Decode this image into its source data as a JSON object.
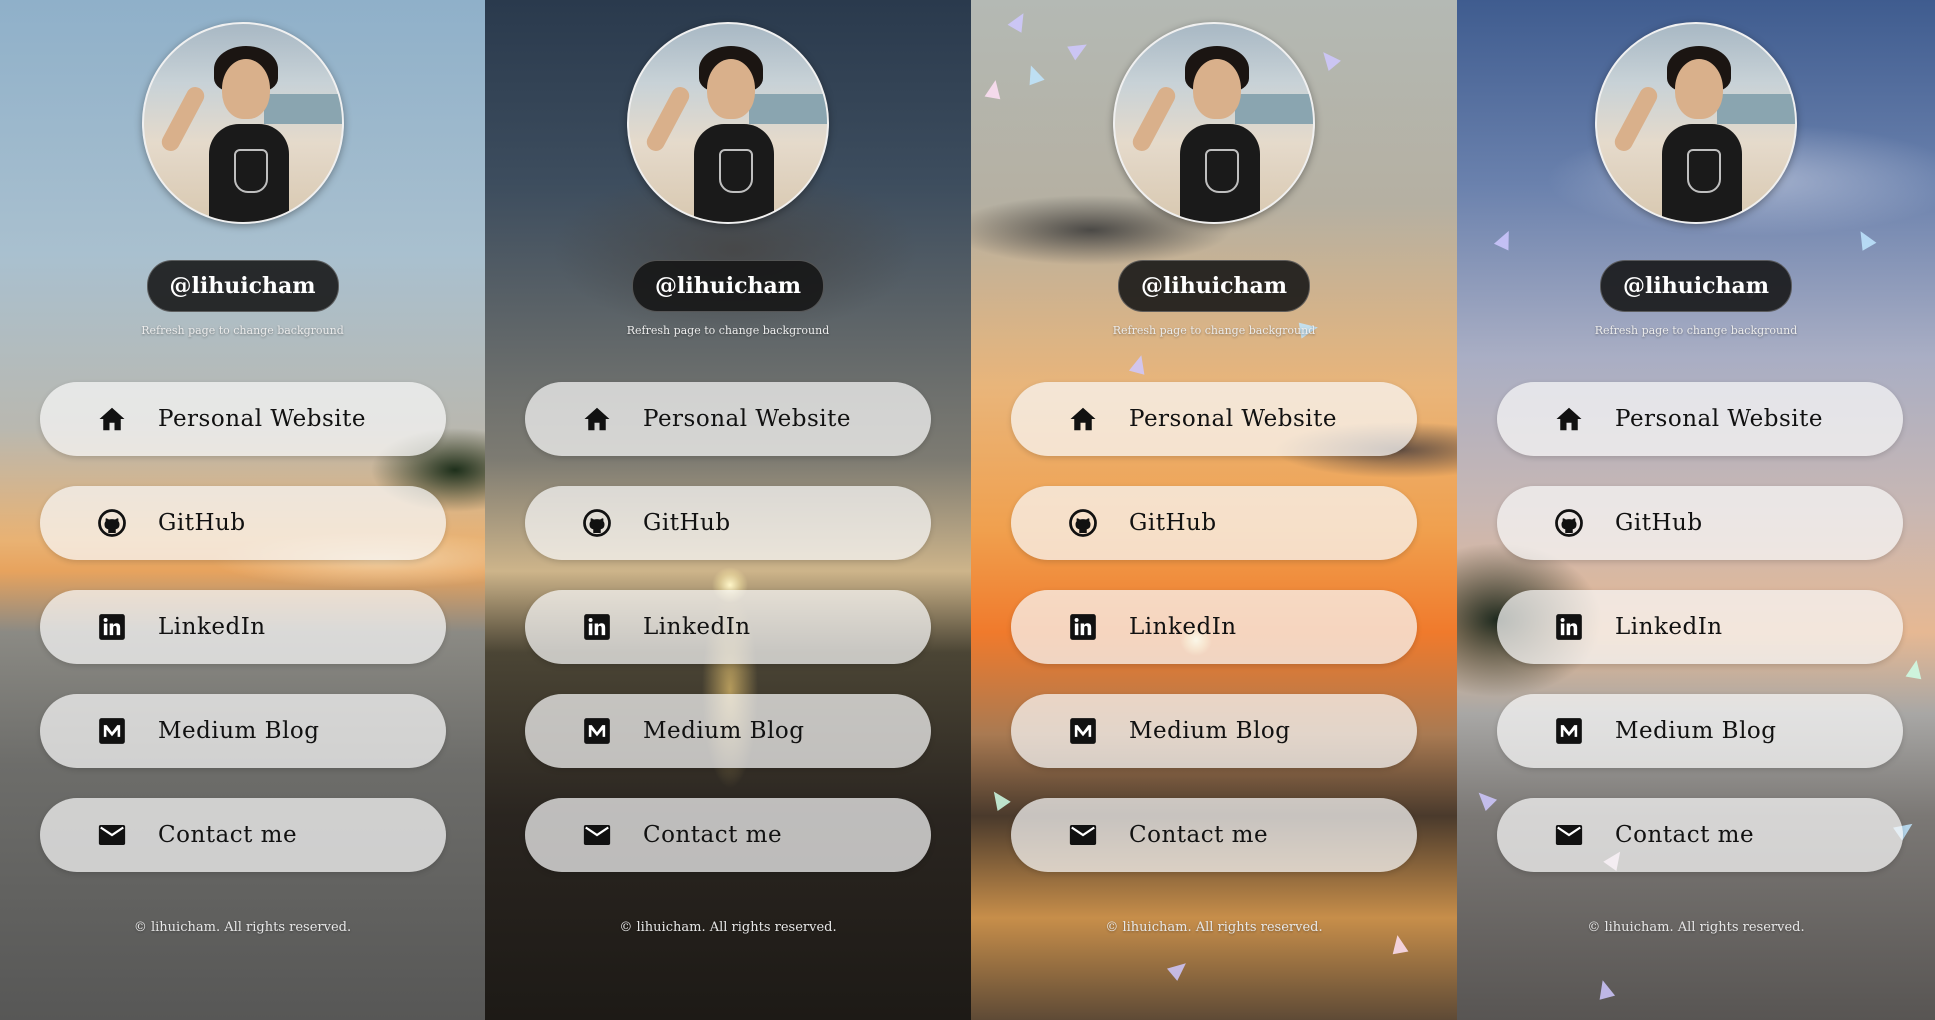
{
  "panels": [
    {
      "handle": "@lihuicham",
      "refresh_note": "Refresh page to change background",
      "links": [
        {
          "label": "Personal Website",
          "icon": "home-icon"
        },
        {
          "label": "GitHub",
          "icon": "github-icon"
        },
        {
          "label": "LinkedIn",
          "icon": "linkedin-icon"
        },
        {
          "label": "Medium Blog",
          "icon": "medium-icon"
        },
        {
          "label": "Contact me",
          "icon": "mail-icon"
        }
      ],
      "footer": "© lihuicham. All rights reserved."
    },
    {
      "handle": "@lihuicham",
      "refresh_note": "Refresh page to change background",
      "links": [
        {
          "label": "Personal Website",
          "icon": "home-icon"
        },
        {
          "label": "GitHub",
          "icon": "github-icon"
        },
        {
          "label": "LinkedIn",
          "icon": "linkedin-icon"
        },
        {
          "label": "Medium Blog",
          "icon": "medium-icon"
        },
        {
          "label": "Contact me",
          "icon": "mail-icon"
        }
      ],
      "footer": "© lihuicham. All rights reserved."
    },
    {
      "handle": "@lihuicham",
      "refresh_note": "Refresh page to change background",
      "links": [
        {
          "label": "Personal Website",
          "icon": "home-icon"
        },
        {
          "label": "GitHub",
          "icon": "github-icon"
        },
        {
          "label": "LinkedIn",
          "icon": "linkedin-icon"
        },
        {
          "label": "Medium Blog",
          "icon": "medium-icon"
        },
        {
          "label": "Contact me",
          "icon": "mail-icon"
        }
      ],
      "footer": "© lihuicham. All rights reserved."
    },
    {
      "handle": "@lihuicham",
      "refresh_note": "Refresh page to change background",
      "links": [
        {
          "label": "Personal Website",
          "icon": "home-icon"
        },
        {
          "label": "GitHub",
          "icon": "github-icon"
        },
        {
          "label": "LinkedIn",
          "icon": "linkedin-icon"
        },
        {
          "label": "Medium Blog",
          "icon": "medium-icon"
        },
        {
          "label": "Contact me",
          "icon": "mail-icon"
        }
      ],
      "footer": "© lihuicham. All rights reserved."
    }
  ],
  "colors": {
    "button_bg": "#f8f8f8",
    "handle_bg": "#141414",
    "icon": "#111111",
    "shard": "#cfc8ff"
  }
}
